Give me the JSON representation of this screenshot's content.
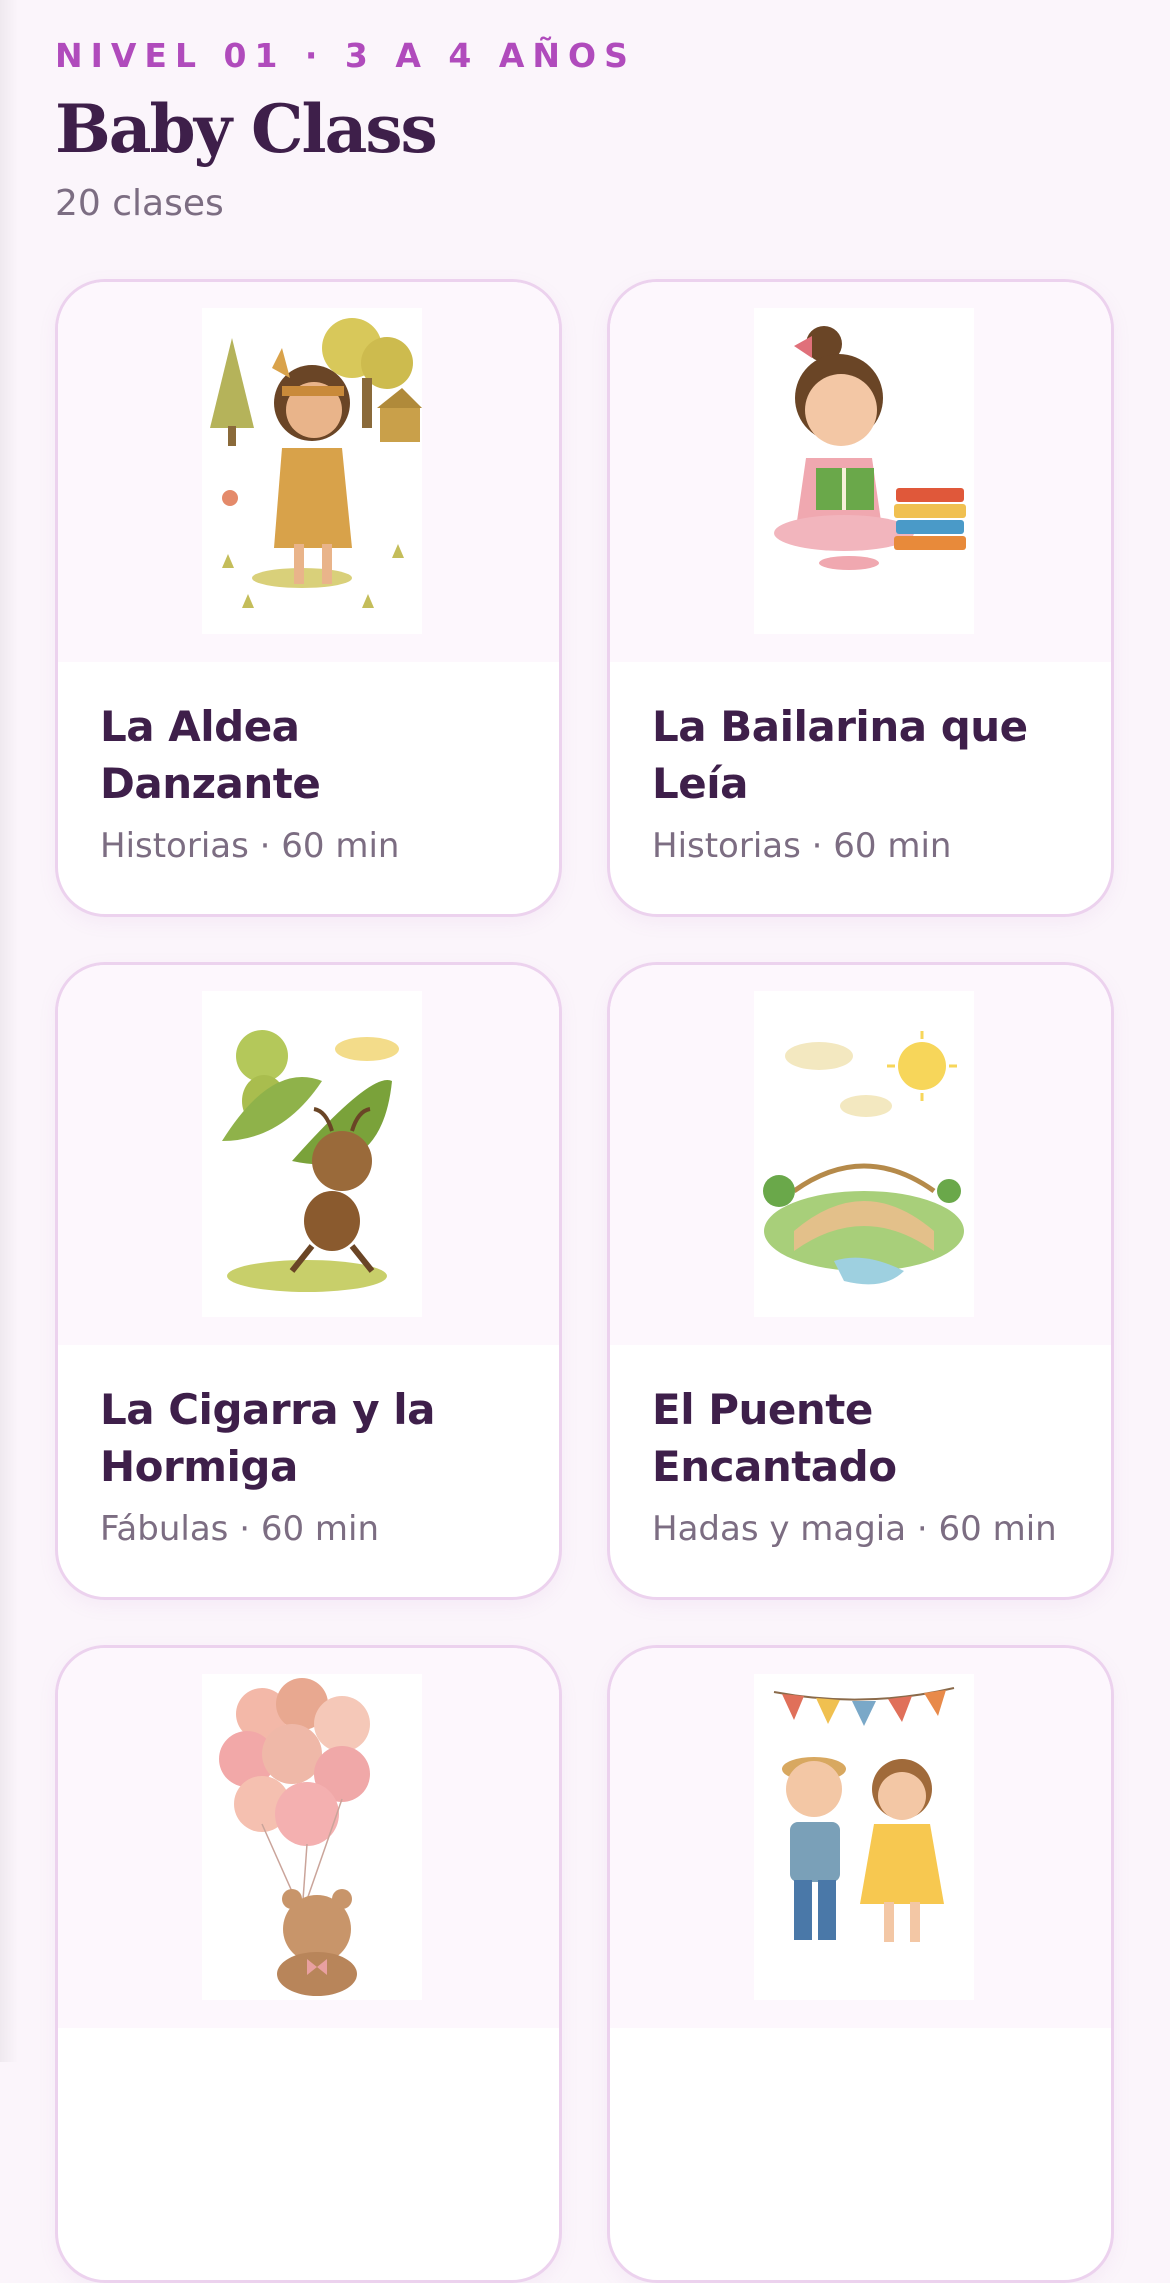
{
  "header": {
    "level_label": "NIVEL 01 · 3 A 4 AÑOS",
    "title": "Baby Class",
    "class_count": "20 clases"
  },
  "cards": [
    {
      "title": "La Aldea Danzante",
      "category": "Historias",
      "duration": "60 min",
      "meta": "Historias · 60 min",
      "illustration": "dancing-girl-illustration"
    },
    {
      "title": "La Bailarina que Leía",
      "category": "Historias",
      "duration": "60 min",
      "meta": "Historias · 60 min",
      "illustration": "reading-ballerina-illustration"
    },
    {
      "title": "La Cigarra y la Hormiga",
      "category": "Fábulas",
      "duration": "60 min",
      "meta": "Fábulas · 60 min",
      "illustration": "cicada-and-ant-illustration"
    },
    {
      "title": "El Puente Encantado",
      "category": "Hadas y magia",
      "duration": "60 min",
      "meta": "Hadas y magia · 60 min",
      "illustration": "enchanted-bridge-illustration"
    },
    {
      "title": "",
      "meta": "",
      "illustration": "teddy-bear-balloons-illustration"
    },
    {
      "title": "",
      "meta": "",
      "illustration": "dancing-children-illustration"
    }
  ],
  "colors": {
    "background": "#fbf5fb",
    "accent": "#b04bbc",
    "title": "#3e1f4a",
    "muted": "#7c6d82",
    "card_border": "#ecd2ee"
  }
}
